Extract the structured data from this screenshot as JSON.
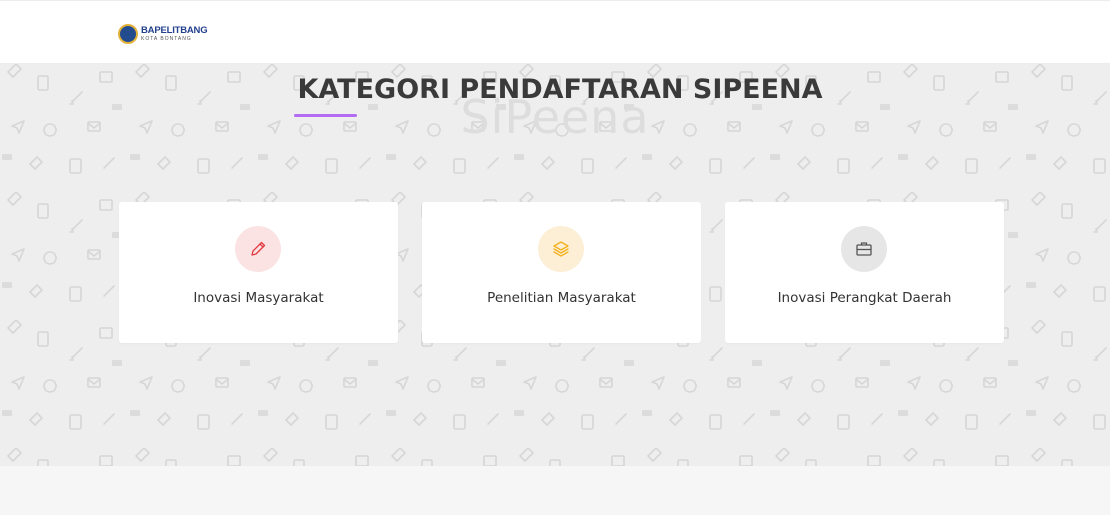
{
  "brand": {
    "name": "BAPELITBANG",
    "sub": "KOTA BONTANG"
  },
  "hero": {
    "watermark": "SiPeena",
    "title": "KATEGORI PENDAFTARAN SIPEENA"
  },
  "categories": [
    {
      "label": "Inovasi Masyarakat",
      "icon": "pencil-icon",
      "color": "#e2383f"
    },
    {
      "label": "Penelitian Masyarakat",
      "icon": "layers-icon",
      "color": "#f2b01e"
    },
    {
      "label": "Inovasi Perangkat Daerah",
      "icon": "briefcase-icon",
      "color": "#555555"
    }
  ],
  "colors": {
    "accent_underline": "#b36bf3",
    "hero_bg": "#eeeeee"
  }
}
